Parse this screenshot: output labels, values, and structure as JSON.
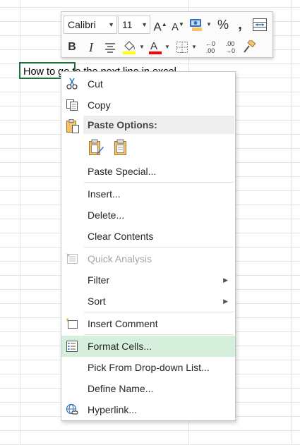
{
  "sheet": {
    "cell_text": "How to go to the next line in excel"
  },
  "mini_toolbar": {
    "font_name": "Calibri",
    "font_size": "11",
    "bold_label": "B",
    "italic_label": "I",
    "percent_label": "%",
    "comma_label": ",",
    "increase_font_label": "A",
    "decrease_font_label": "A",
    "inc_decimal_top": "←0",
    "inc_decimal_bottom": ".00",
    "dec_decimal_top": ".00",
    "dec_decimal_bottom": "→0",
    "highlight_color": "#ffff00",
    "font_color": "#ff0000"
  },
  "menu": {
    "cut": "Cut",
    "copy": "Copy",
    "paste_options": "Paste Options:",
    "paste_special": "Paste Special...",
    "insert": "Insert...",
    "delete": "Delete...",
    "clear_contents": "Clear Contents",
    "quick_analysis": "Quick Analysis",
    "filter": "Filter",
    "sort": "Sort",
    "insert_comment": "Insert Comment",
    "format_cells": "Format Cells...",
    "pick_from_list": "Pick From Drop-down List...",
    "define_name": "Define Name...",
    "hyperlink": "Hyperlink..."
  },
  "colors": {
    "selection_border": "#1f6f43",
    "menu_highlight": "#d6efdd",
    "paste_header_bg": "#eeeeee"
  }
}
